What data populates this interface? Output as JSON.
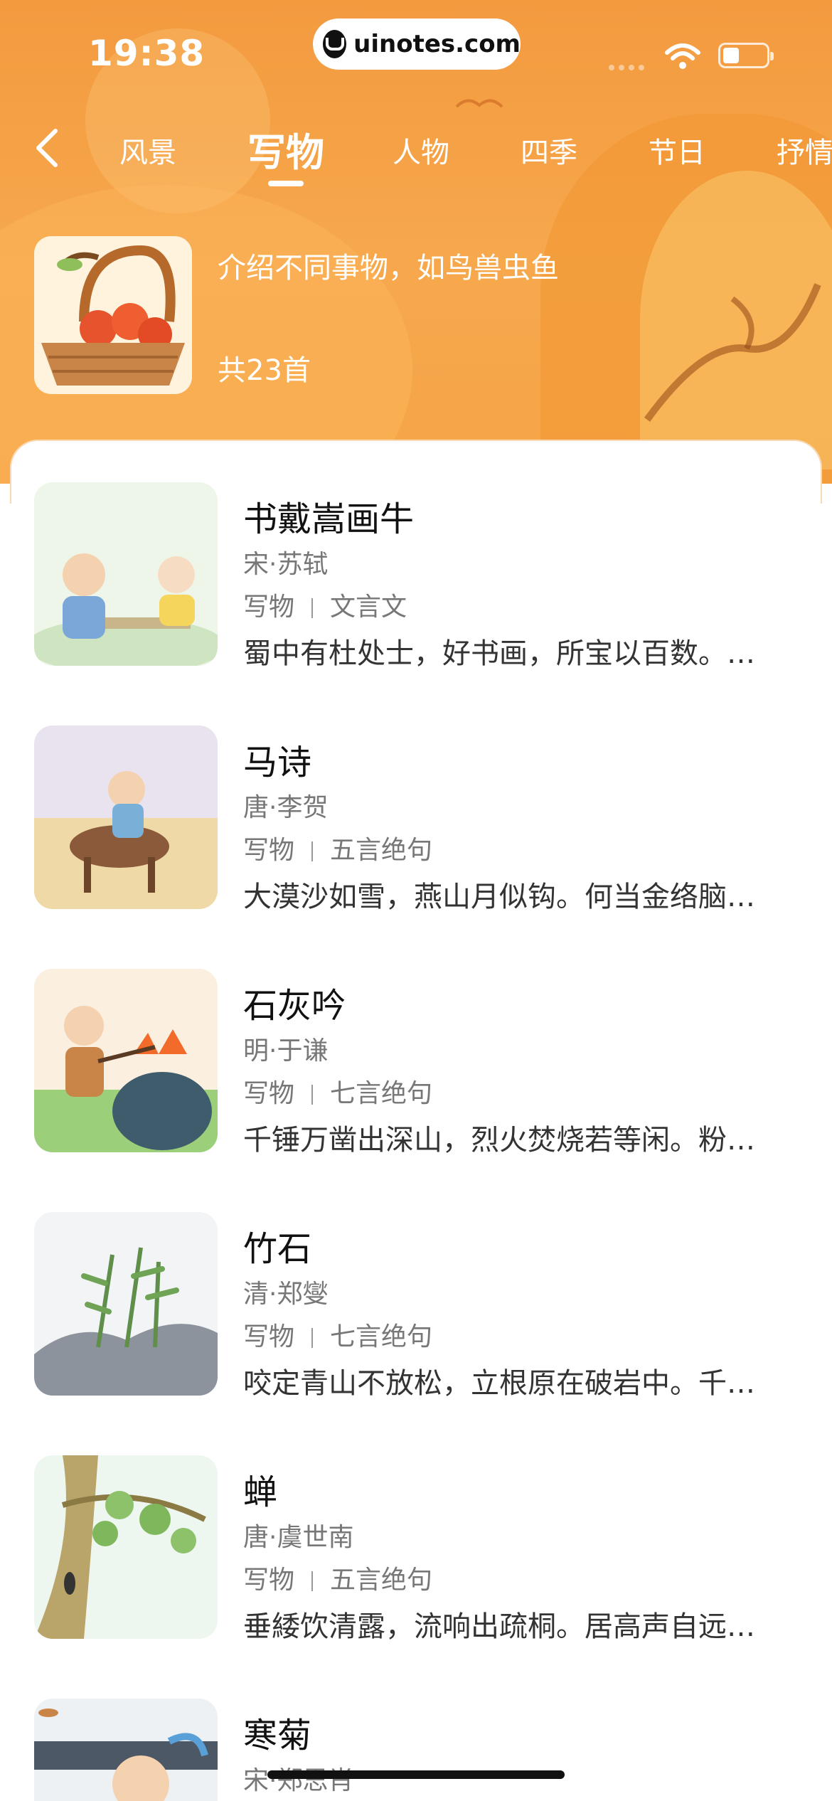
{
  "status_bar": {
    "time": "19:38",
    "url": "uinotes.com"
  },
  "nav": {
    "tabs": [
      {
        "label": "风景"
      },
      {
        "label": "写物",
        "active": true
      },
      {
        "label": "人物"
      },
      {
        "label": "四季"
      },
      {
        "label": "节日"
      },
      {
        "label": "抒情"
      }
    ]
  },
  "category": {
    "description": "介绍不同事物，如鸟兽虫鱼",
    "count": "共23首"
  },
  "poems": [
    {
      "title": "书戴嵩画牛",
      "author": "宋·苏轼",
      "tag1": "写物",
      "tag2": "文言文",
      "excerpt": "蜀中有杜处士，好书画，所宝以百数。…"
    },
    {
      "title": "马诗",
      "author": "唐·李贺",
      "tag1": "写物",
      "tag2": "五言绝句",
      "excerpt": "大漠沙如雪，燕山月似钩。何当金络脑…"
    },
    {
      "title": "石灰吟",
      "author": "明·于谦",
      "tag1": "写物",
      "tag2": "七言绝句",
      "excerpt": "千锤万凿出深山，烈火焚烧若等闲。粉…"
    },
    {
      "title": "竹石",
      "author": "清·郑燮",
      "tag1": "写物",
      "tag2": "七言绝句",
      "excerpt": "咬定青山不放松，立根原在破岩中。千…"
    },
    {
      "title": "蝉",
      "author": "唐·虞世南",
      "tag1": "写物",
      "tag2": "五言绝句",
      "excerpt": "垂緌饮清露，流响出疏桐。居高声自远…"
    },
    {
      "title": "寒菊",
      "author": "宋·郑思肖",
      "tag1": "",
      "tag2": "",
      "excerpt": ""
    }
  ],
  "colors": {
    "header": "#f39a3f",
    "accent": "#ffffff"
  }
}
